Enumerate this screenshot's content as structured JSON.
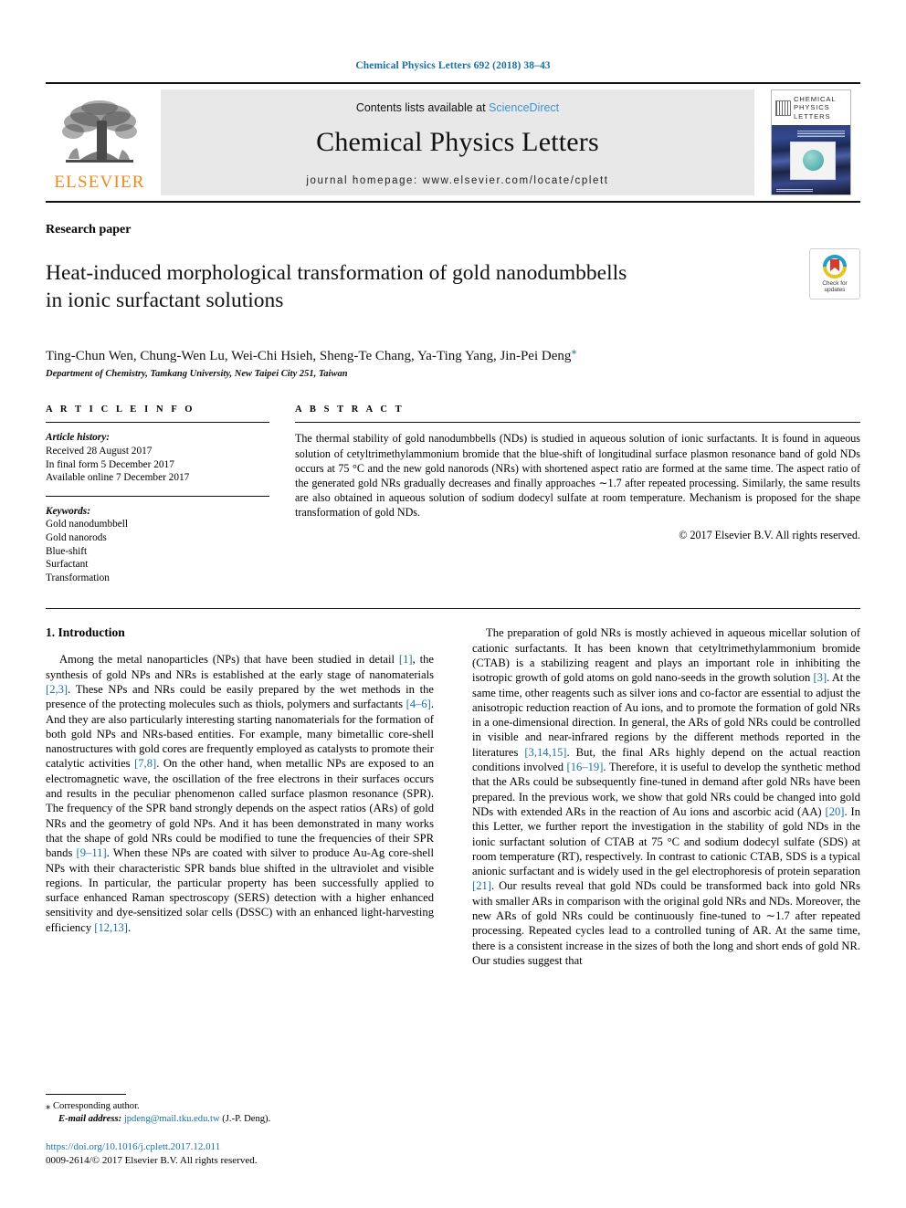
{
  "running_head": "Chemical Physics Letters 692 (2018) 38–43",
  "masthead": {
    "publisher_name": "ELSEVIER",
    "contents_prefix": "Contents lists available at ",
    "contents_link": "ScienceDirect",
    "journal_title": "Chemical Physics Letters",
    "homepage": "journal homepage: www.elsevier.com/locate/cplett",
    "cover": {
      "line1": "CHEMICAL",
      "line2": "PHYSICS",
      "line3": "LETTERS"
    }
  },
  "article": {
    "type_label": "Research paper",
    "title_line1": "Heat-induced morphological transformation of gold nanodumbbells",
    "title_line2": "in ionic surfactant solutions",
    "authors": "Ting-Chun Wen, Chung-Wen Lu, Wei-Chi Hsieh, Sheng-Te Chang, Ya-Ting Yang, Jin-Pei Deng",
    "corresponding_marker": "⁎",
    "affiliation": "Department of Chemistry, Tamkang University, New Taipei City 251, Taiwan",
    "crossmark_line1": "Check for",
    "crossmark_line2": "updates"
  },
  "article_info": {
    "heading": "A R T I C L E   I N F O",
    "history_label": "Article history:",
    "history": [
      "Received 28 August 2017",
      "In final form 5 December 2017",
      "Available online 7 December 2017"
    ],
    "keywords_label": "Keywords:",
    "keywords": [
      "Gold nanodumbbell",
      "Gold nanorods",
      "Blue-shift",
      "Surfactant",
      "Transformation"
    ]
  },
  "abstract": {
    "heading": "A B S T R A C T",
    "text": "The thermal stability of gold nanodumbbells (NDs) is studied in aqueous solution of ionic surfactants. It is found in aqueous solution of cetyltrimethylammonium bromide that the blue-shift of longitudinal surface plasmon resonance band of gold NDs occurs at 75 °C and the new gold nanorods (NRs) with shortened aspect ratio are formed at the same time. The aspect ratio of the generated gold NRs gradually decreases and finally approaches ∼1.7 after repeated processing. Similarly, the same results are also obtained in aqueous solution of sodium dodecyl sulfate at room temperature. Mechanism is proposed for the shape transformation of gold NDs.",
    "copyright": "© 2017 Elsevier B.V. All rights reserved."
  },
  "body": {
    "section1_heading": "1. Introduction",
    "left_paragraph": "Among the metal nanoparticles (NPs) that have been studied in detail [1], the synthesis of gold NPs and NRs is established at the early stage of nanomaterials [2,3]. These NPs and NRs could be easily prepared by the wet methods in the presence of the protecting molecules such as thiols, polymers and surfactants [4–6]. And they are also particularly interesting starting nanomaterials for the formation of both gold NPs and NRs-based entities. For example, many bimetallic core-shell nanostructures with gold cores are frequently employed as catalysts to promote their catalytic activities [7,8]. On the other hand, when metallic NPs are exposed to an electromagnetic wave, the oscillation of the free electrons in their surfaces occurs and results in the peculiar phenomenon called surface plasmon resonance (SPR). The frequency of the SPR band strongly depends on the aspect ratios (ARs) of gold NRs and the geometry of gold NPs. And it has been demonstrated in many works that the shape of gold NRs could be modified to tune the frequencies of their SPR bands [9–11]. When these NPs are coated with silver to produce Au-Ag core-shell NPs with their characteristic SPR bands blue shifted in the ultraviolet and visible regions. In particular, the particular property has been successfully applied to surface enhanced Raman spectroscopy (SERS) detection with a higher enhanced sensitivity and dye-sensitized solar cells (DSSC) with an enhanced light-harvesting efficiency [12,13].",
    "right_paragraph": "The preparation of gold NRs is mostly achieved in aqueous micellar solution of cationic surfactants. It has been known that cetyltrimethylammonium bromide (CTAB) is a stabilizing reagent and plays an important role in inhibiting the isotropic growth of gold atoms on gold nano-seeds in the growth solution [3]. At the same time, other reagents such as silver ions and co-factor are essential to adjust the anisotropic reduction reaction of Au ions, and to promote the formation of gold NRs in a one-dimensional direction. In general, the ARs of gold NRs could be controlled in visible and near-infrared regions by the different methods reported in the literatures [3,14,15]. But, the final ARs highly depend on the actual reaction conditions involved [16–19]. Therefore, it is useful to develop the synthetic method that the ARs could be subsequently fine-tuned in demand after gold NRs have been prepared. In the previous work, we show that gold NRs could be changed into gold NDs with extended ARs in the reaction of Au ions and ascorbic acid (AA) [20]. In this Letter, we further report the investigation in the stability of gold NDs in the ionic surfactant solution of CTAB at 75 °C and sodium dodecyl sulfate (SDS) at room temperature (RT), respectively. In contrast to cationic CTAB, SDS is a typical anionic surfactant and is widely used in the gel electrophoresis of protein separation [21]. Our results reveal that gold NDs could be transformed back into gold NRs with smaller ARs in comparison with the original gold NRs and NDs. Moreover, the new ARs of gold NRs could be continuously fine-tuned to ∼1.7 after repeated processing. Repeated cycles lead to a controlled tuning of AR. At the same time, there is a consistent increase in the sizes of both the long and short ends of gold NR. Our studies suggest that"
  },
  "footnote": {
    "star": "⁎",
    "corresponding": "Corresponding author.",
    "email_label": "E-mail address:",
    "email": "jpdeng@mail.tku.edu.tw",
    "email_suffix": "(J.-P. Deng).",
    "doi": "https://doi.org/10.1016/j.cplett.2017.12.011",
    "issn_line": "0009-2614/© 2017 Elsevier B.V. All rights reserved."
  },
  "colors": {
    "link_blue": "#1a6fa3",
    "sciencedirect_blue": "#3f93d4",
    "elsevier_orange": "#ed8b1f"
  }
}
